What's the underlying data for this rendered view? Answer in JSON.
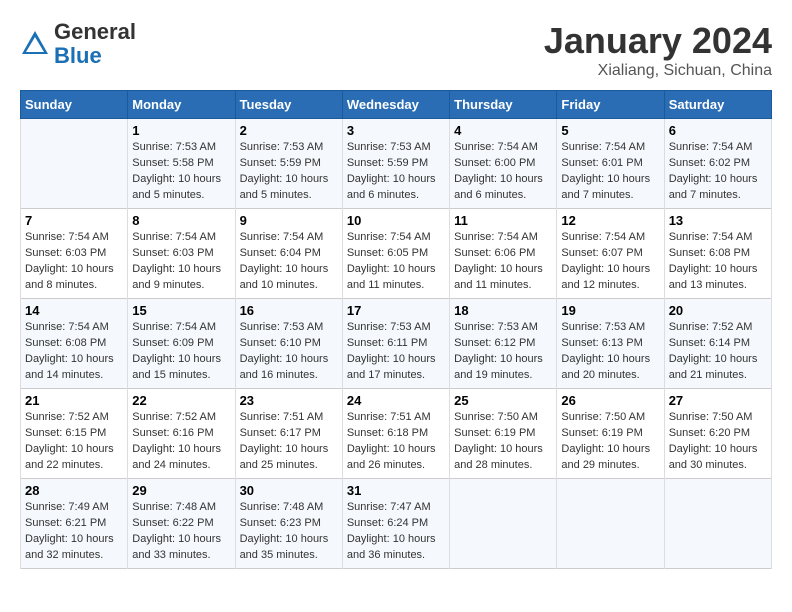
{
  "header": {
    "logo_general": "General",
    "logo_blue": "Blue",
    "month_title": "January 2024",
    "subtitle": "Xialiang, Sichuan, China"
  },
  "columns": [
    "Sunday",
    "Monday",
    "Tuesday",
    "Wednesday",
    "Thursday",
    "Friday",
    "Saturday"
  ],
  "weeks": [
    [
      {
        "day": "",
        "info": ""
      },
      {
        "day": "1",
        "info": "Sunrise: 7:53 AM\nSunset: 5:58 PM\nDaylight: 10 hours\nand 5 minutes."
      },
      {
        "day": "2",
        "info": "Sunrise: 7:53 AM\nSunset: 5:59 PM\nDaylight: 10 hours\nand 5 minutes."
      },
      {
        "day": "3",
        "info": "Sunrise: 7:53 AM\nSunset: 5:59 PM\nDaylight: 10 hours\nand 6 minutes."
      },
      {
        "day": "4",
        "info": "Sunrise: 7:54 AM\nSunset: 6:00 PM\nDaylight: 10 hours\nand 6 minutes."
      },
      {
        "day": "5",
        "info": "Sunrise: 7:54 AM\nSunset: 6:01 PM\nDaylight: 10 hours\nand 7 minutes."
      },
      {
        "day": "6",
        "info": "Sunrise: 7:54 AM\nSunset: 6:02 PM\nDaylight: 10 hours\nand 7 minutes."
      }
    ],
    [
      {
        "day": "7",
        "info": "Sunrise: 7:54 AM\nSunset: 6:03 PM\nDaylight: 10 hours\nand 8 minutes."
      },
      {
        "day": "8",
        "info": "Sunrise: 7:54 AM\nSunset: 6:03 PM\nDaylight: 10 hours\nand 9 minutes."
      },
      {
        "day": "9",
        "info": "Sunrise: 7:54 AM\nSunset: 6:04 PM\nDaylight: 10 hours\nand 10 minutes."
      },
      {
        "day": "10",
        "info": "Sunrise: 7:54 AM\nSunset: 6:05 PM\nDaylight: 10 hours\nand 11 minutes."
      },
      {
        "day": "11",
        "info": "Sunrise: 7:54 AM\nSunset: 6:06 PM\nDaylight: 10 hours\nand 11 minutes."
      },
      {
        "day": "12",
        "info": "Sunrise: 7:54 AM\nSunset: 6:07 PM\nDaylight: 10 hours\nand 12 minutes."
      },
      {
        "day": "13",
        "info": "Sunrise: 7:54 AM\nSunset: 6:08 PM\nDaylight: 10 hours\nand 13 minutes."
      }
    ],
    [
      {
        "day": "14",
        "info": "Sunrise: 7:54 AM\nSunset: 6:08 PM\nDaylight: 10 hours\nand 14 minutes."
      },
      {
        "day": "15",
        "info": "Sunrise: 7:54 AM\nSunset: 6:09 PM\nDaylight: 10 hours\nand 15 minutes."
      },
      {
        "day": "16",
        "info": "Sunrise: 7:53 AM\nSunset: 6:10 PM\nDaylight: 10 hours\nand 16 minutes."
      },
      {
        "day": "17",
        "info": "Sunrise: 7:53 AM\nSunset: 6:11 PM\nDaylight: 10 hours\nand 17 minutes."
      },
      {
        "day": "18",
        "info": "Sunrise: 7:53 AM\nSunset: 6:12 PM\nDaylight: 10 hours\nand 19 minutes."
      },
      {
        "day": "19",
        "info": "Sunrise: 7:53 AM\nSunset: 6:13 PM\nDaylight: 10 hours\nand 20 minutes."
      },
      {
        "day": "20",
        "info": "Sunrise: 7:52 AM\nSunset: 6:14 PM\nDaylight: 10 hours\nand 21 minutes."
      }
    ],
    [
      {
        "day": "21",
        "info": "Sunrise: 7:52 AM\nSunset: 6:15 PM\nDaylight: 10 hours\nand 22 minutes."
      },
      {
        "day": "22",
        "info": "Sunrise: 7:52 AM\nSunset: 6:16 PM\nDaylight: 10 hours\nand 24 minutes."
      },
      {
        "day": "23",
        "info": "Sunrise: 7:51 AM\nSunset: 6:17 PM\nDaylight: 10 hours\nand 25 minutes."
      },
      {
        "day": "24",
        "info": "Sunrise: 7:51 AM\nSunset: 6:18 PM\nDaylight: 10 hours\nand 26 minutes."
      },
      {
        "day": "25",
        "info": "Sunrise: 7:50 AM\nSunset: 6:19 PM\nDaylight: 10 hours\nand 28 minutes."
      },
      {
        "day": "26",
        "info": "Sunrise: 7:50 AM\nSunset: 6:19 PM\nDaylight: 10 hours\nand 29 minutes."
      },
      {
        "day": "27",
        "info": "Sunrise: 7:50 AM\nSunset: 6:20 PM\nDaylight: 10 hours\nand 30 minutes."
      }
    ],
    [
      {
        "day": "28",
        "info": "Sunrise: 7:49 AM\nSunset: 6:21 PM\nDaylight: 10 hours\nand 32 minutes."
      },
      {
        "day": "29",
        "info": "Sunrise: 7:48 AM\nSunset: 6:22 PM\nDaylight: 10 hours\nand 33 minutes."
      },
      {
        "day": "30",
        "info": "Sunrise: 7:48 AM\nSunset: 6:23 PM\nDaylight: 10 hours\nand 35 minutes."
      },
      {
        "day": "31",
        "info": "Sunrise: 7:47 AM\nSunset: 6:24 PM\nDaylight: 10 hours\nand 36 minutes."
      },
      {
        "day": "",
        "info": ""
      },
      {
        "day": "",
        "info": ""
      },
      {
        "day": "",
        "info": ""
      }
    ]
  ]
}
